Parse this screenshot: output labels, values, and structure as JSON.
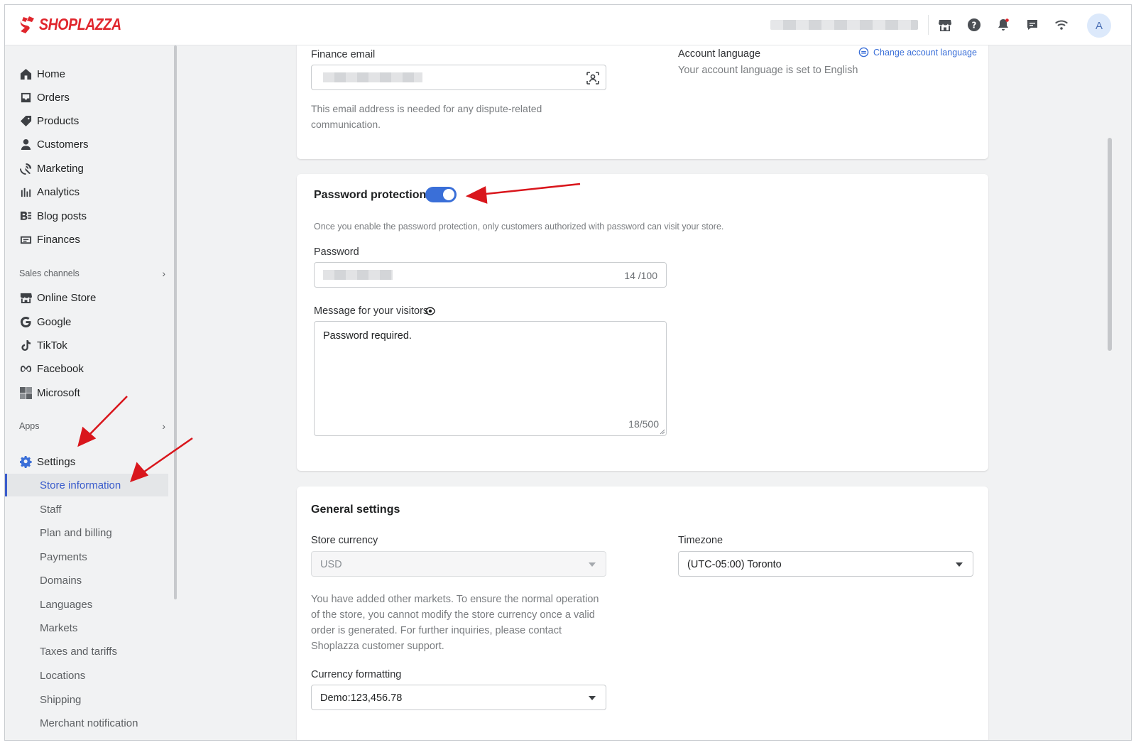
{
  "brand": {
    "name": "SHOPLAZZA",
    "color": "#e0262d"
  },
  "topbar": {
    "icons": [
      "store-icon",
      "help-icon",
      "bell-icon",
      "chat-icon",
      "wifi-icon"
    ],
    "avatar_initial": "A"
  },
  "sidebar": {
    "main_items": [
      {
        "label": "Home",
        "icon": "home-icon"
      },
      {
        "label": "Orders",
        "icon": "orders-icon"
      },
      {
        "label": "Products",
        "icon": "tag-icon"
      },
      {
        "label": "Customers",
        "icon": "person-icon"
      },
      {
        "label": "Marketing",
        "icon": "marketing-icon"
      },
      {
        "label": "Analytics",
        "icon": "analytics-icon"
      },
      {
        "label": "Blog posts",
        "icon": "blog-icon"
      },
      {
        "label": "Finances",
        "icon": "finances-icon"
      }
    ],
    "sales_channels_label": "Sales channels",
    "channels": [
      {
        "label": "Online Store",
        "icon": "store-icon"
      },
      {
        "label": "Google",
        "icon": "google-icon"
      },
      {
        "label": "TikTok",
        "icon": "tiktok-icon"
      },
      {
        "label": "Facebook",
        "icon": "meta-icon"
      },
      {
        "label": "Microsoft",
        "icon": "microsoft-icon"
      }
    ],
    "apps_label": "Apps",
    "settings_label": "Settings",
    "settings_items": [
      "Store information",
      "Staff",
      "Plan and billing",
      "Payments",
      "Domains",
      "Languages",
      "Markets",
      "Taxes and tariffs",
      "Locations",
      "Shipping",
      "Merchant notification"
    ],
    "active_item": "Store information",
    "accent_color": "#3a5ccc"
  },
  "contact_card": {
    "finance_email_label": "Finance email",
    "finance_email_help": "This email address is needed for any dispute-related communication.",
    "account_language_label": "Account language",
    "change_language_link": "Change account language",
    "account_language_text": "Your account language is set to English"
  },
  "password_card": {
    "title": "Password protection",
    "enabled": true,
    "description": "Once you enable the password protection, only customers authorized with password can visit your store.",
    "password_label": "Password",
    "password_counter": "14 /100",
    "message_label": "Message for your visitors",
    "message_value": "Password required.",
    "message_counter": "18/500"
  },
  "general_card": {
    "title": "General settings",
    "store_currency_label": "Store currency",
    "store_currency_value": "USD",
    "store_currency_help": "You have added other markets. To ensure the normal operation of the store, you cannot modify the store currency once a valid order is generated. For further inquiries, please contact Shoplazza customer support.",
    "timezone_label": "Timezone",
    "timezone_value": "(UTC-05:00) Toronto",
    "currency_formatting_label": "Currency formatting",
    "currency_formatting_value": "Demo:123,456.78"
  },
  "annotation_color": "#d9161c"
}
